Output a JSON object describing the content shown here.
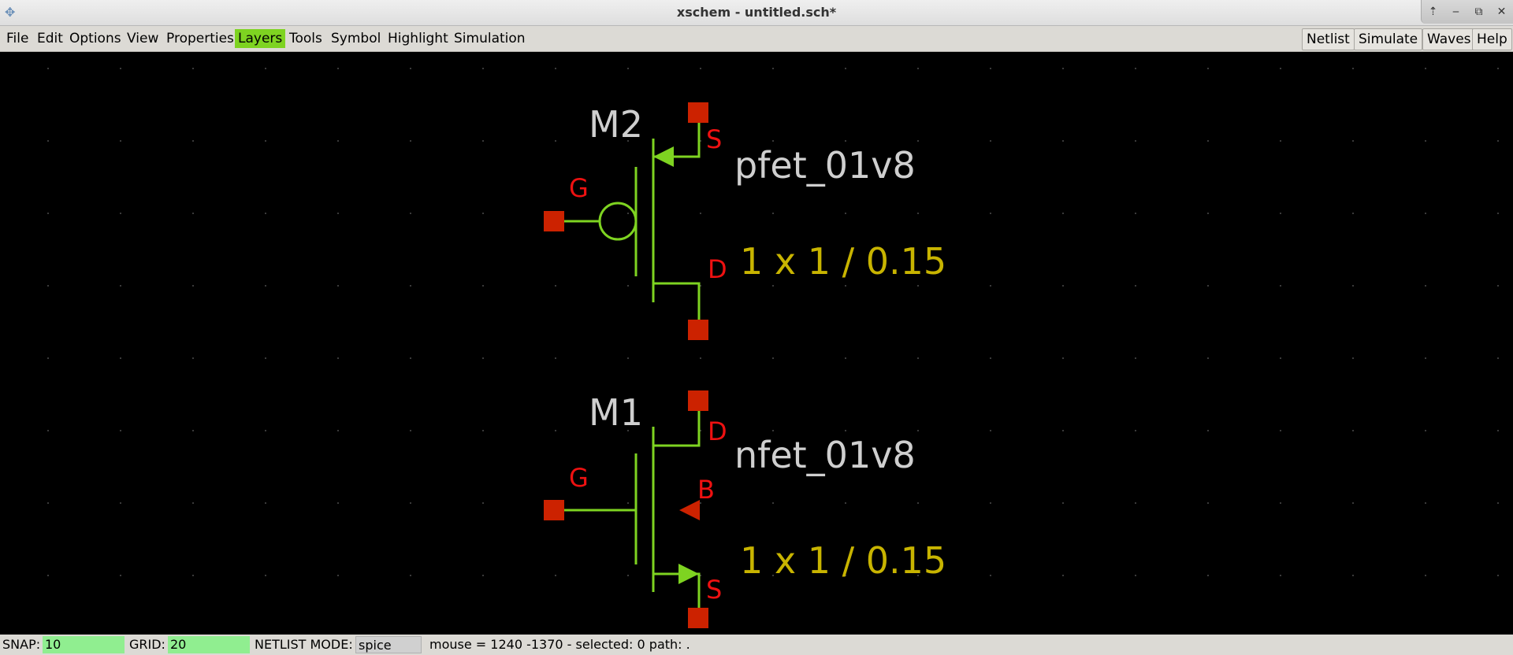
{
  "window": {
    "title": "xschem - untitled.sch*",
    "app_icon": "xschem-icon"
  },
  "window_controls": [
    {
      "name": "raise-button",
      "glyph": "⇡"
    },
    {
      "name": "minimize-button",
      "glyph": "‒"
    },
    {
      "name": "maximize-button",
      "glyph": "⧉"
    },
    {
      "name": "close-button",
      "glyph": "✕"
    }
  ],
  "menu": {
    "items": [
      "File",
      "Edit",
      "Options",
      "View",
      "Properties",
      "Layers",
      "Tools",
      "Symbol",
      "Highlight",
      "Simulation"
    ],
    "active": "Layers"
  },
  "toolbar_buttons": [
    "Netlist",
    "Simulate",
    "Waves",
    "Help"
  ],
  "schematic": {
    "pfet": {
      "instance": "M2",
      "model": "pfet_01v8",
      "size": "1 x 1 / 0.15",
      "pins": {
        "gate": "G",
        "source": "S",
        "drain": "D"
      }
    },
    "nfet": {
      "instance": "M1",
      "model": "nfet_01v8",
      "size": "1 x 1 / 0.15",
      "pins": {
        "gate": "G",
        "source": "S",
        "drain": "D",
        "body": "B"
      }
    },
    "colors": {
      "wire": "#7ed321",
      "pin": "#cc2200",
      "pin_label": "#ee1111",
      "label": "#cfcfcf",
      "size_label": "#c8b400",
      "grid_dot": "#3a3a3a"
    }
  },
  "statusbar": {
    "snap_label": "SNAP:",
    "snap_value": "10",
    "grid_label": "GRID:",
    "grid_value": "20",
    "netlist_label": "NETLIST MODE:",
    "netlist_value": "spice",
    "info": "mouse = 1240 -1370 - selected: 0 path: ."
  }
}
